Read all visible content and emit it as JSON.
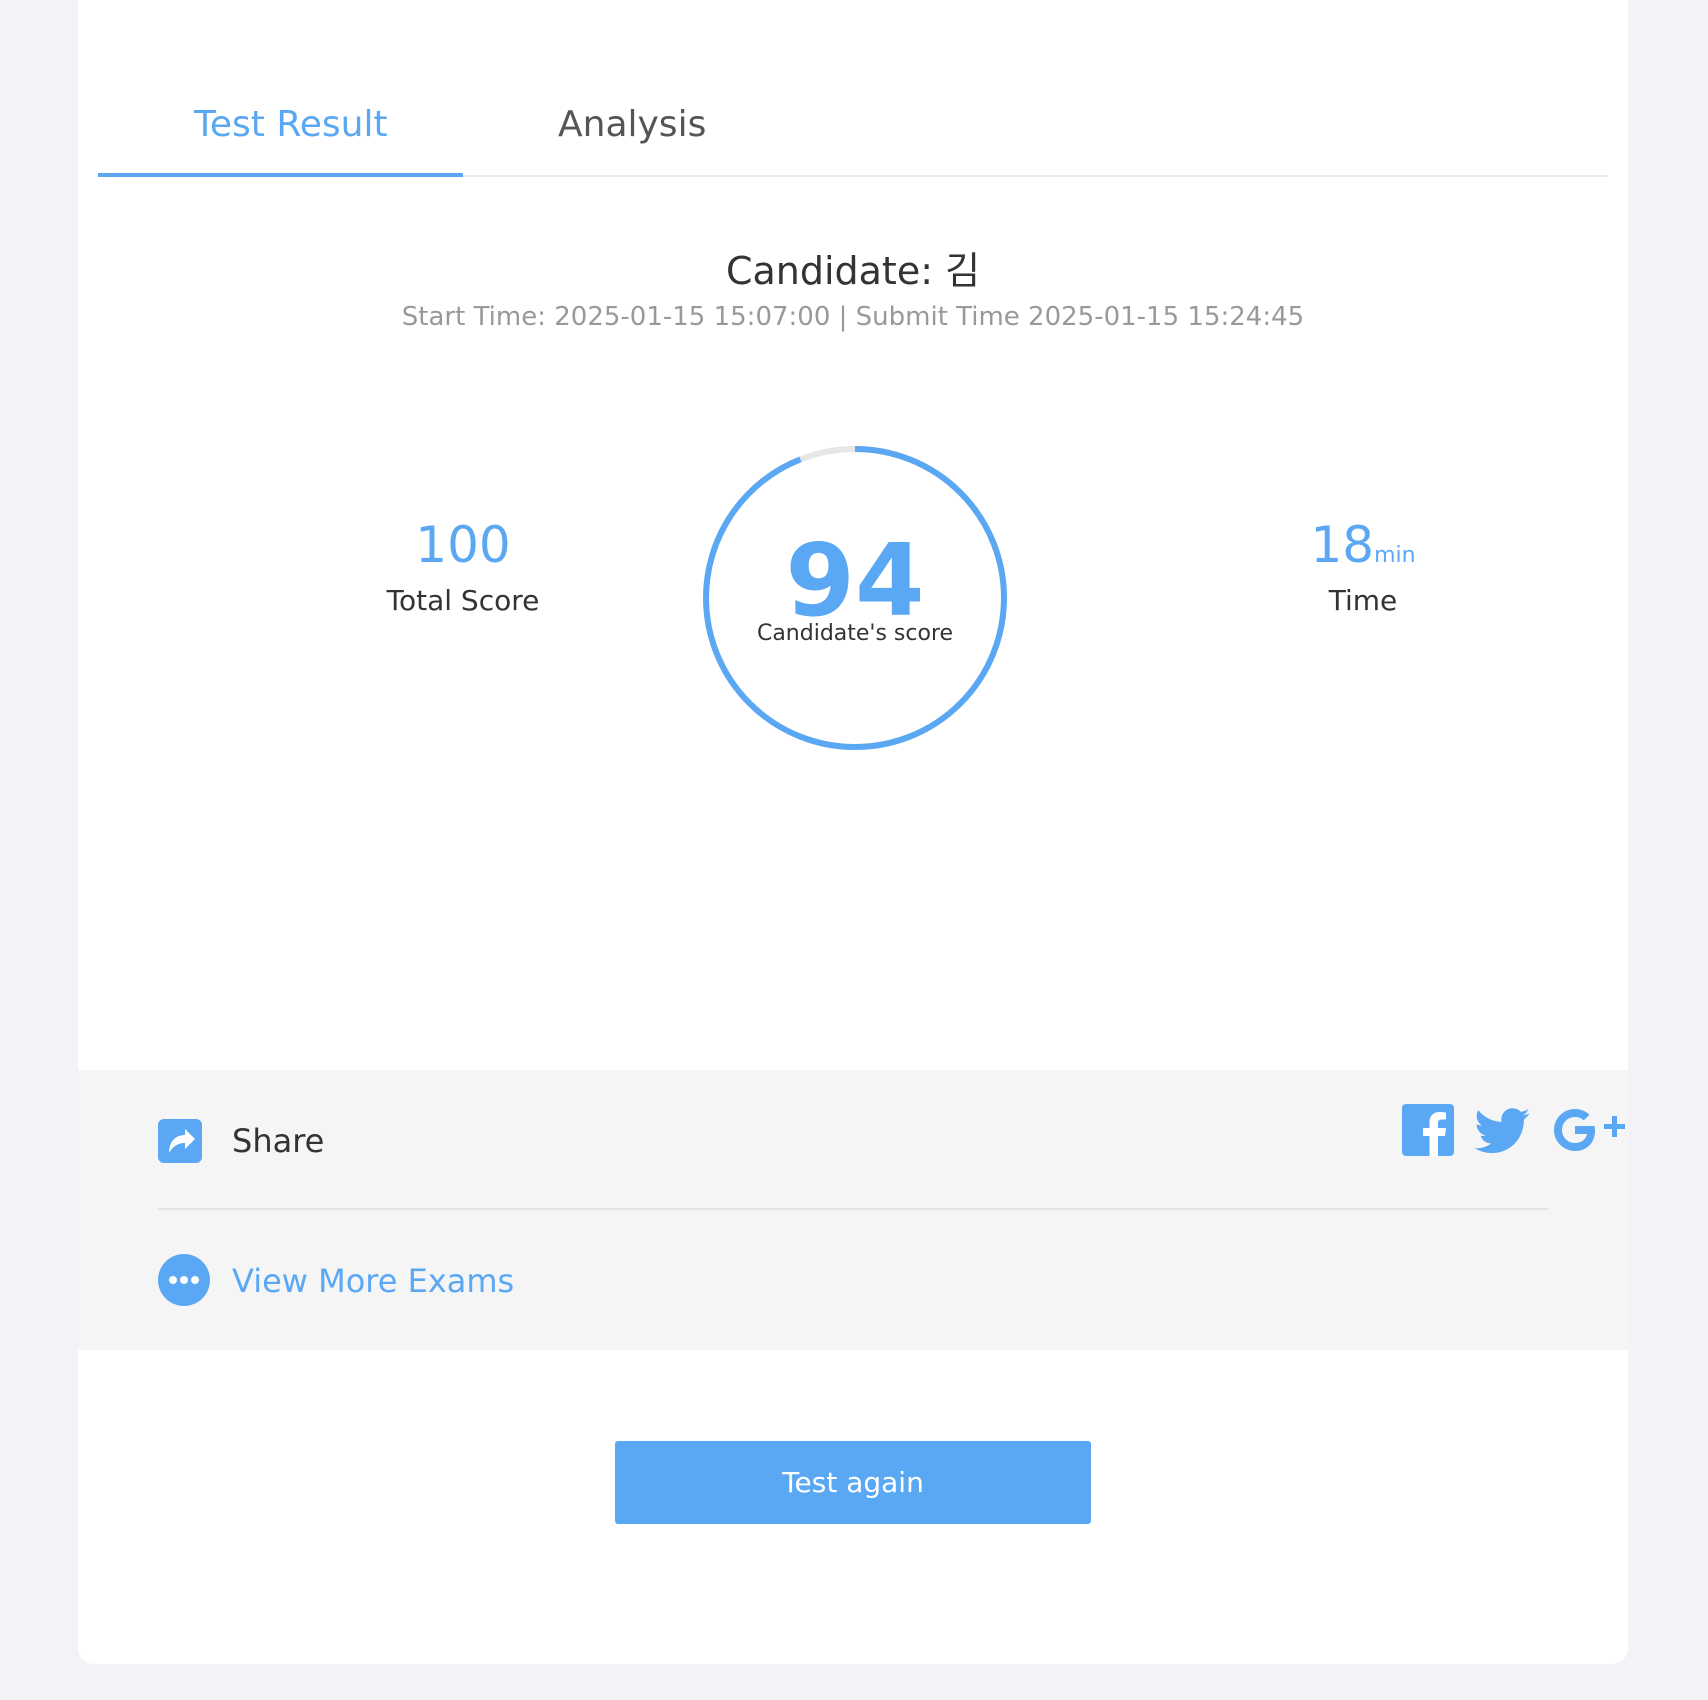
{
  "tabs": [
    {
      "label": "Test Result",
      "active": true
    },
    {
      "label": "Analysis",
      "active": false
    }
  ],
  "header": {
    "candidate": "Candidate: 김",
    "times": "Start Time:  2025-01-15 15:07:00 | Submit Time 2025-01-15 15:24:45"
  },
  "stats": {
    "total_score": {
      "value": "100",
      "label": "Total Score"
    },
    "candidate_score": {
      "value": "94",
      "label": "Candidate's score",
      "progress_fraction": 0.94
    },
    "time": {
      "value": "18",
      "unit": "min",
      "label": "Time"
    }
  },
  "share": {
    "label": "Share",
    "icons": [
      "facebook-icon",
      "twitter-icon",
      "google-plus-icon"
    ]
  },
  "more": {
    "label": "View More Exams"
  },
  "actions": {
    "test_again": "Test again"
  },
  "colors": {
    "accent": "#5aa8f3",
    "page_background": "#f2f3f7",
    "panel_background": "#f5f5f6",
    "ring_track": "#e6e6e6"
  }
}
